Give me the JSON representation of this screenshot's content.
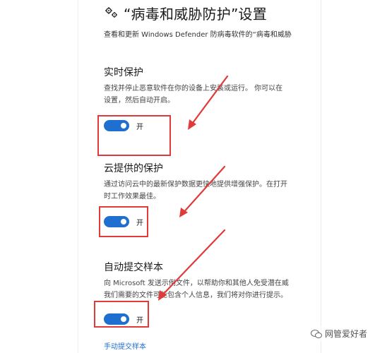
{
  "header": {
    "title": "“病毒和威胁防护”设置",
    "subtitle": "查看和更新 Windows Defender 防病毒软件的“病毒和威胁"
  },
  "sections": [
    {
      "title": "实时保护",
      "desc1": "查找并停止恶意软件在你的设备上安装或运行。 你可以在",
      "desc2": "设置，然后自动开启。",
      "toggle_label": "开"
    },
    {
      "title": "云提供的保护",
      "desc1": "通过访问云中的最新保护数据更快地提供增强保护。在打开",
      "desc2": "时工作效果最佳。",
      "toggle_label": "开"
    },
    {
      "title": "自动提交样本",
      "desc1": "向 Microsoft 发送示例文件，以帮助你和其他人免受潜在威",
      "desc2": "我们需要的文件可能包含个人信息，我们将对你进行提示。",
      "toggle_label": "开"
    }
  ],
  "manual_submit_link": "手动提交样本",
  "watermark": "网管爱好者",
  "colors": {
    "accent": "#1e6fd0",
    "annotation": "#e03a3a"
  },
  "toggles": [
    true,
    true,
    true
  ]
}
